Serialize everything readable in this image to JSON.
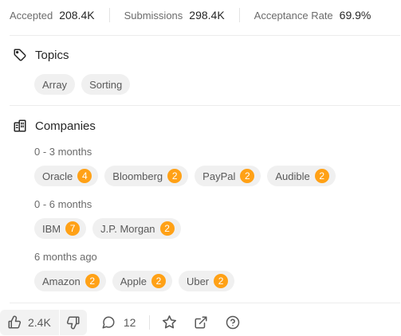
{
  "stats": [
    {
      "label": "Accepted",
      "value": "208.4K"
    },
    {
      "label": "Submissions",
      "value": "298.4K"
    },
    {
      "label": "Acceptance Rate",
      "value": "69.9%"
    }
  ],
  "topics": {
    "title": "Topics",
    "tags": [
      "Array",
      "Sorting"
    ]
  },
  "companies": {
    "title": "Companies",
    "groups": [
      {
        "period": "0 - 3 months",
        "items": [
          {
            "name": "Oracle",
            "count": "4"
          },
          {
            "name": "Bloomberg",
            "count": "2"
          },
          {
            "name": "PayPal",
            "count": "2"
          },
          {
            "name": "Audible",
            "count": "2"
          }
        ]
      },
      {
        "period": "0 - 6 months",
        "items": [
          {
            "name": "IBM",
            "count": "7"
          },
          {
            "name": "J.P. Morgan",
            "count": "2"
          }
        ]
      },
      {
        "period": "6 months ago",
        "items": [
          {
            "name": "Amazon",
            "count": "2"
          },
          {
            "name": "Apple",
            "count": "2"
          },
          {
            "name": "Uber",
            "count": "2"
          }
        ]
      }
    ]
  },
  "footer": {
    "likes": "2.4K",
    "comments": "12",
    "icons": [
      "thumbs-up-icon",
      "thumbs-down-icon",
      "comment-icon",
      "star-icon",
      "external-link-icon",
      "help-icon"
    ]
  },
  "colors": {
    "badge": "#ffa116",
    "pill_bg": "#f0f0f0",
    "muted_text": "#6b6b6b"
  }
}
